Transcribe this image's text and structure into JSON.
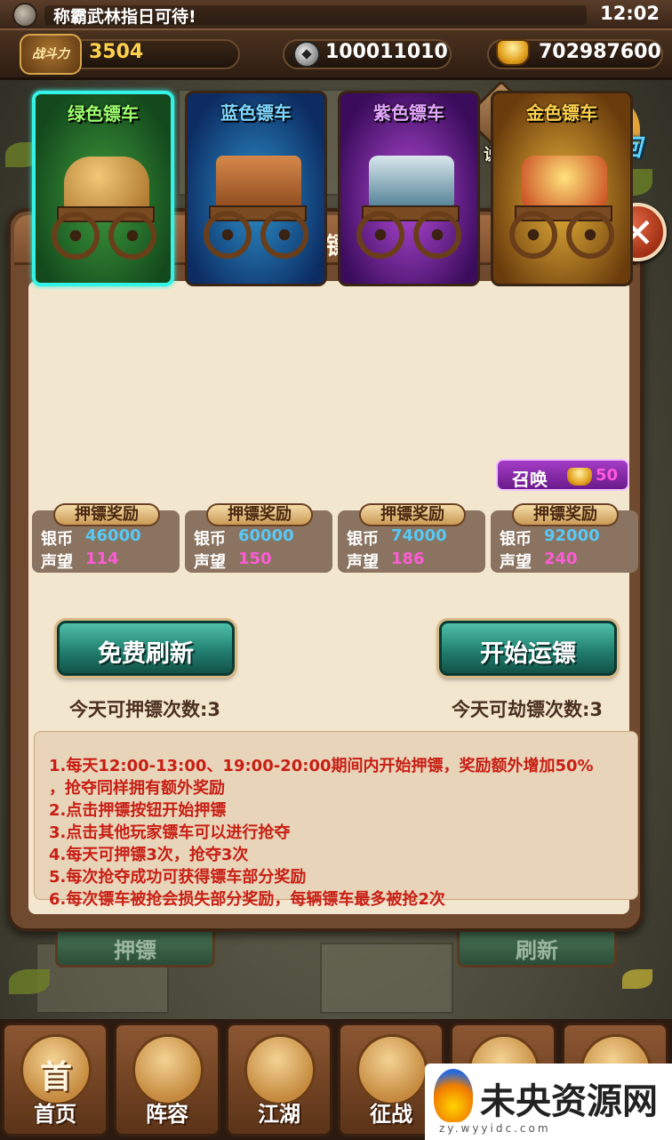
{
  "status_bar": {
    "headline": "称霸武林指日可待!",
    "time": "12:02"
  },
  "resources": {
    "power_badge": "战斗力",
    "power": "3504",
    "silver": "100011010",
    "gold": "702987600"
  },
  "top_buttons": {
    "explain": "说明",
    "back": "返回"
  },
  "dialog": {
    "title": "押镖",
    "close": "✕",
    "carts": [
      {
        "name": "绿色镖车",
        "color": "#33f2e6",
        "selected": true
      },
      {
        "name": "蓝色镖车",
        "color": "#2d8fc9",
        "selected": false
      },
      {
        "name": "紫色镖车",
        "color": "#b24ad8",
        "selected": false
      },
      {
        "name": "金色镖车",
        "color": "#e7b23a",
        "selected": false
      }
    ],
    "summon": {
      "label": "召唤",
      "cost": "50"
    },
    "rewards": [
      {
        "tag": "押镖奖励",
        "silver_label": "银币",
        "silver": "46000",
        "fame_label": "声望",
        "fame": "114"
      },
      {
        "tag": "押镖奖励",
        "silver_label": "银币",
        "silver": "60000",
        "fame_label": "声望",
        "fame": "150"
      },
      {
        "tag": "押镖奖励",
        "silver_label": "银币",
        "silver": "74000",
        "fame_label": "声望",
        "fame": "186"
      },
      {
        "tag": "押镖奖励",
        "silver_label": "银币",
        "silver": "92000",
        "fame_label": "声望",
        "fame": "240"
      }
    ],
    "free_refresh": "免费刷新",
    "start_escort": "开始运镖",
    "escort_count": "今天可押镖次数:3",
    "rob_count": "今天可劫镖次数:3",
    "rules": [
      "1.每天12:00-13:00、19:00-20:00期间内开始押镖，奖励额外增加50%",
      "，抢夺同样拥有额外奖励",
      "2.点击押镖按钮开始押镖",
      "3.点击其他玩家镖车可以进行抢夺",
      "4.每天可押镖3次，抢夺3次",
      "5.每次抢夺成功可获得镖车部分奖励",
      "6.每次镖车被抢会损失部分奖励，每辆镖车最多被抢2次"
    ]
  },
  "behind_buttons": {
    "left": "押镖",
    "right": "刷新"
  },
  "nav": [
    {
      "glyph": "首",
      "label": "首页"
    },
    {
      "glyph": "",
      "label": "阵容"
    },
    {
      "glyph": "",
      "label": "江湖"
    },
    {
      "glyph": "",
      "label": "征战"
    },
    {
      "glyph": "",
      "label": ""
    },
    {
      "glyph": "",
      "label": ""
    }
  ],
  "watermark": {
    "text": "未央资源网",
    "sub": "zy.wyyidc.com"
  }
}
